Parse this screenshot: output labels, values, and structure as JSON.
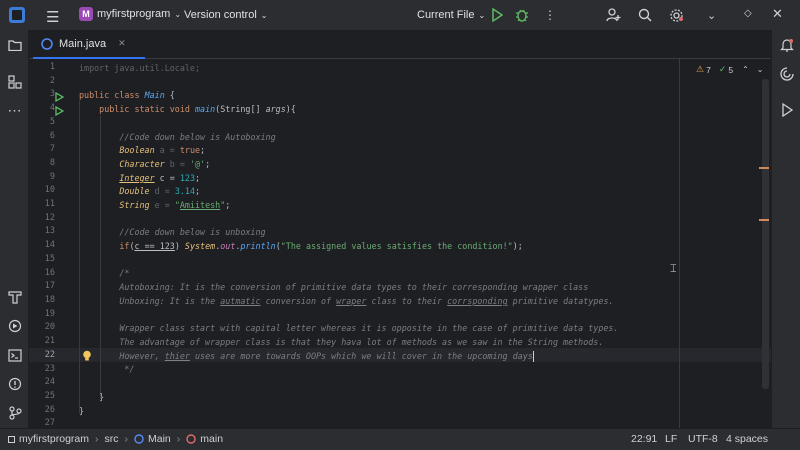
{
  "titlebar": {
    "project_badge": "M",
    "project_name": "myfirstprogram",
    "vcs": "Version control",
    "run_config": "Current File"
  },
  "tab": {
    "label": "Main.java"
  },
  "inspections": {
    "warnings": "7",
    "weak_warnings": "5"
  },
  "lines": [
    {
      "n": "1"
    },
    {
      "n": "2"
    },
    {
      "n": "3"
    },
    {
      "n": "4"
    },
    {
      "n": "5"
    },
    {
      "n": "6"
    },
    {
      "n": "7"
    },
    {
      "n": "8"
    },
    {
      "n": "9"
    },
    {
      "n": "10"
    },
    {
      "n": "11"
    },
    {
      "n": "12"
    },
    {
      "n": "13"
    },
    {
      "n": "14"
    },
    {
      "n": "15"
    },
    {
      "n": "16"
    },
    {
      "n": "17"
    },
    {
      "n": "18"
    },
    {
      "n": "19"
    },
    {
      "n": "20"
    },
    {
      "n": "21"
    },
    {
      "n": "22"
    },
    {
      "n": "23"
    },
    {
      "n": "24"
    },
    {
      "n": "25"
    },
    {
      "n": "26"
    },
    {
      "n": "27"
    }
  ],
  "code": {
    "l1": "import java.util.Locale;",
    "l3a": "public class ",
    "l3b": "Main",
    "l3c": " {",
    "l4a": "    public static void ",
    "l4b": "main",
    "l4c": "(String[] ",
    "l4d": "args",
    "l4e": "){",
    "l6": "        //Code down below is Autoboxing",
    "l7a": "        ",
    "l7b": "Boolean",
    "l7c": " a = ",
    "l7d": "true",
    "l7e": ";",
    "l8a": "        ",
    "l8b": "Character",
    "l8c": " b = ",
    "l8d": "'@'",
    "l8e": ";",
    "l9a": "        ",
    "l9b": "Integer",
    "l9c": " c = ",
    "l9d": "123",
    "l9e": ";",
    "l10a": "        ",
    "l10b": "Double",
    "l10c": " d = ",
    "l10d": "3.14",
    "l10e": ";",
    "l11a": "        ",
    "l11b": "String",
    "l11c": " e = ",
    "l11d": "\"",
    "l11e": "Amiitesh",
    "l11f": "\"",
    "l11g": ";",
    "l13": "        //Code down below is unboxing",
    "l14a": "        ",
    "l14b": "if",
    "l14c": "(",
    "l14d": "c == 123",
    "l14e": ") ",
    "l14f": "System",
    "l14g": ".",
    "l14h": "out",
    "l14i": ".",
    "l14j": "println",
    "l14k": "(",
    "l14l": "\"The assigned values satisfies the condition!\"",
    "l14m": ");",
    "l16": "        /*",
    "l17": "        Autoboxing: It is the conversion of primitive data types to their corresponding wrapper class",
    "l18a": "        Unboxing: It is the ",
    "l18b": "autmatic",
    "l18c": " conversion of ",
    "l18d": "wraper",
    "l18e": " class to their ",
    "l18f": "corrsponding",
    "l18g": " primitive datatypes.",
    "l20": "        Wrapper class start with capital letter whereas it is opposite in the case of primitive data types.",
    "l21": "        The advantage of wrapper class is that they hava lot of methods as we saw in the String methods.",
    "l22a": "        However, ",
    "l22b": "thier",
    "l22c": " uses are more towards OOPs which we will cover in the upcoming days",
    "l23": "         */",
    "l25": "    }",
    "l26": "}"
  },
  "status": {
    "project": "myfirstprogram",
    "src": "src",
    "class": "Main",
    "method": "main",
    "position": "22:91",
    "line_sep": "LF",
    "encoding": "UTF-8",
    "indent": "4 spaces"
  }
}
